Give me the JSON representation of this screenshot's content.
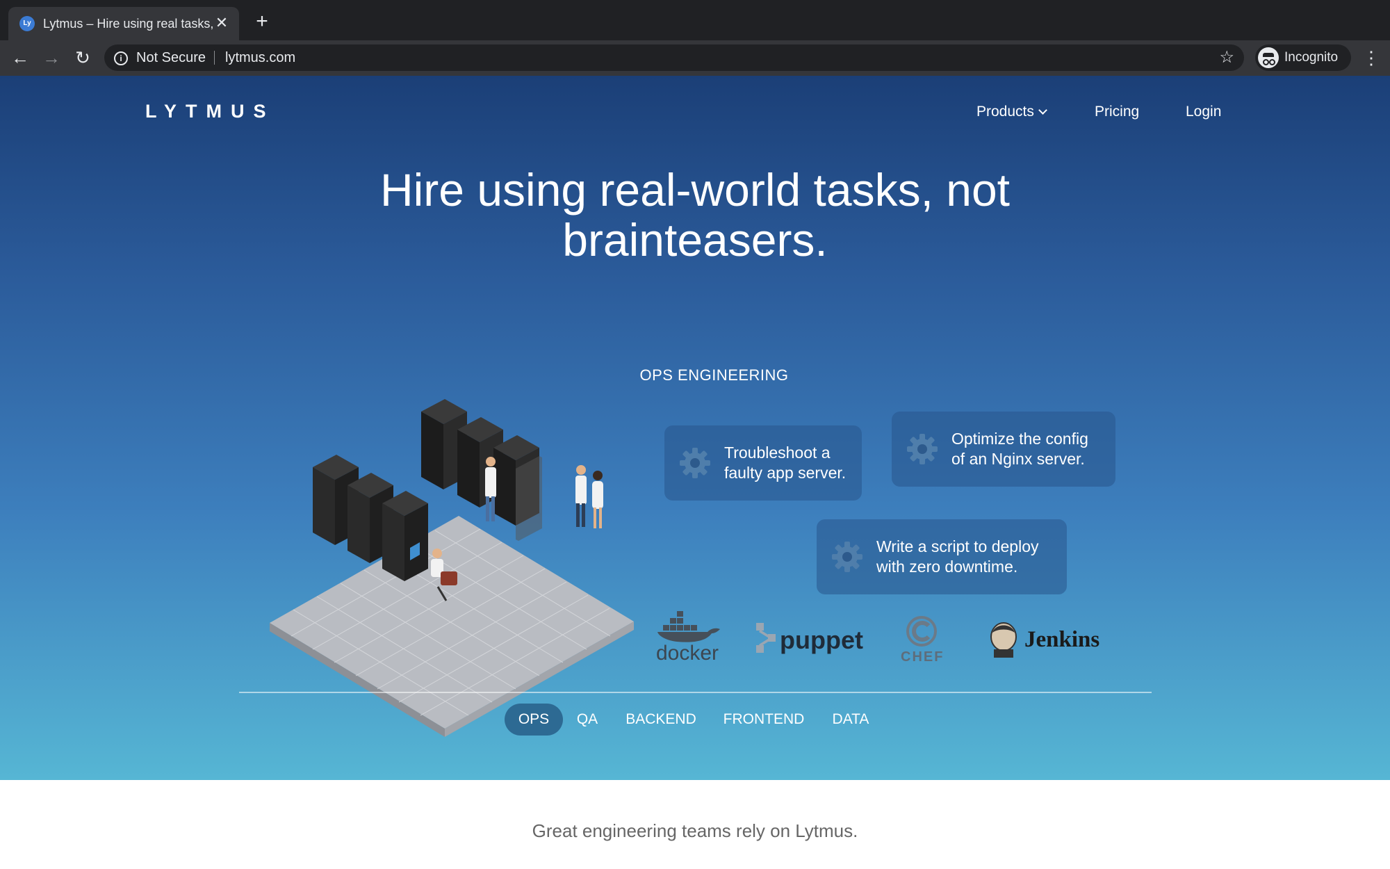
{
  "browser": {
    "tab_title": "Lytmus – Hire using real tasks,",
    "tab_favicon_text": "Ly",
    "security_label": "Not Secure",
    "url": "lytmus.com",
    "profile_label": "Incognito",
    "icons": [
      "back-arrow-icon",
      "forward-arrow-icon",
      "reload-icon",
      "info-icon",
      "star-icon",
      "incognito-icon",
      "more-vert-icon",
      "close-icon",
      "plus-icon"
    ]
  },
  "site": {
    "logo": "LYTMUS",
    "nav": {
      "products": "Products",
      "pricing": "Pricing",
      "login": "Login"
    },
    "headline_line1": "Hire using real-world tasks, not",
    "headline_line2": "brainteasers.",
    "section_label": "OPS ENGINEERING",
    "tasks": [
      {
        "text": "Troubleshoot a\nfaulty app server."
      },
      {
        "text": "Optimize the config\nof an Nginx server."
      },
      {
        "text": "Write a script to deploy\nwith zero downtime."
      }
    ],
    "tools": {
      "docker": "docker",
      "puppet": "puppet",
      "chef": "CHEF",
      "jenkins": "Jenkins"
    },
    "categories": [
      {
        "label": "OPS",
        "active": true
      },
      {
        "label": "QA",
        "active": false
      },
      {
        "label": "BACKEND",
        "active": false
      },
      {
        "label": "FRONTEND",
        "active": false
      },
      {
        "label": "DATA",
        "active": false
      }
    ],
    "tagline": "Great engineering teams rely on Lytmus."
  },
  "colors": {
    "hero_top": "#1b3f77",
    "hero_bottom": "#56b6d4",
    "active_tab": "#2d6a93"
  }
}
